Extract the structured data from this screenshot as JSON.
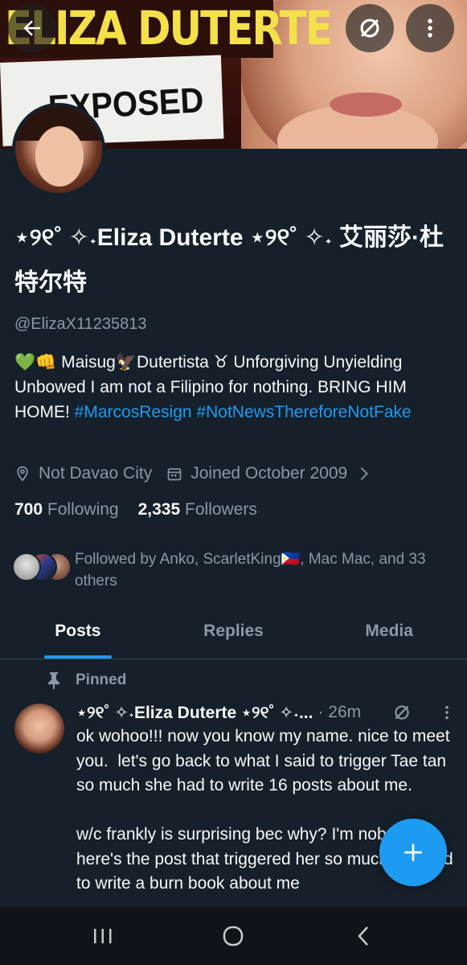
{
  "banner": {
    "title_text": "ELIZA DUTERTE",
    "subtitle_text": "EXPOSED"
  },
  "profile": {
    "display_name": "⋆୨୧˚ ✧˖Eliza Duterte ⋆୨୧˚ ✧˖ 艾丽莎·杜特尔特",
    "handle": "@ElizaX11235813",
    "bio_prefix": "💚👊 Maisug🦅Dutertista ♉ Unforgiving Unyielding Unbowed I am not a Filipino for nothing.  BRING HIM HOME! ",
    "bio_tag1": "#MarcosResign",
    "bio_tag2": "#NotNewsThereforeNotFake",
    "location": "Not Davao City",
    "joined": "Joined October 2009",
    "following_count": "700",
    "following_label": "Following",
    "followers_count": "2,335",
    "followers_label": "Followers",
    "followed_by": "Followed by Anko, ScarletKing🇵🇭, Mac Mac, and 33 others"
  },
  "tabs": [
    {
      "label": "Posts"
    },
    {
      "label": "Replies"
    },
    {
      "label": "Media"
    }
  ],
  "post": {
    "pinned_label": "Pinned",
    "author": "⋆୨୧˚ ✧˖Eliza Duterte ⋆୨୧˚ ✧˖...",
    "time": "· 26m",
    "body": "ok wohoo!!! now you know my name. nice to meet you.  let's go back to what I said to trigger Tae tan so much she had to write 16 posts about me.\n\nw/c frankly is surprising bec why? I'm nobody.  here's the post that triggered her so much she had to write a burn book about me"
  },
  "colors": {
    "background": "#15202b",
    "accent": "#1d9bf0",
    "secondary_text": "#8b98a5"
  }
}
